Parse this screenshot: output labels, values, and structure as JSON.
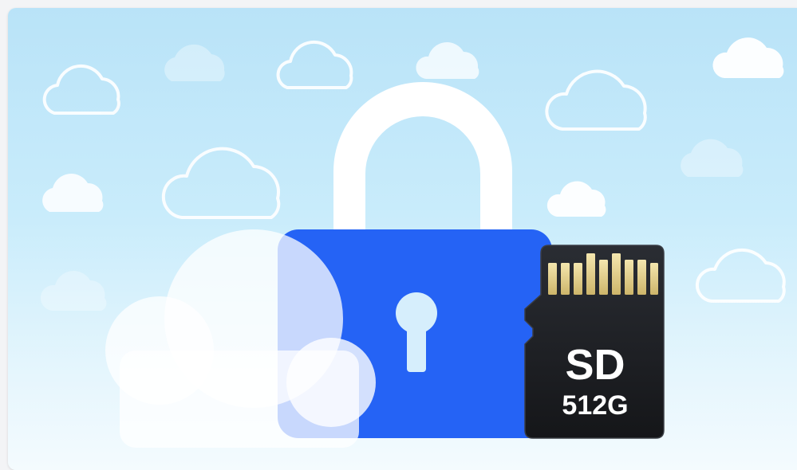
{
  "illustration": {
    "sd_card": {
      "label": "SD",
      "capacity": "512G"
    },
    "icons": [
      "cloud-icon",
      "padlock-icon",
      "keyhole-icon",
      "sd-card-icon"
    ],
    "colors": {
      "background_top": "#b9e3f8",
      "background_bottom": "#f4fbfe",
      "lock_body": "#2563f5",
      "lock_shackle": "#ffffff",
      "sd_card_body": "#1a1c20",
      "sd_card_contacts": "#e9d89a",
      "cloud_fill": "#ffffff"
    }
  }
}
